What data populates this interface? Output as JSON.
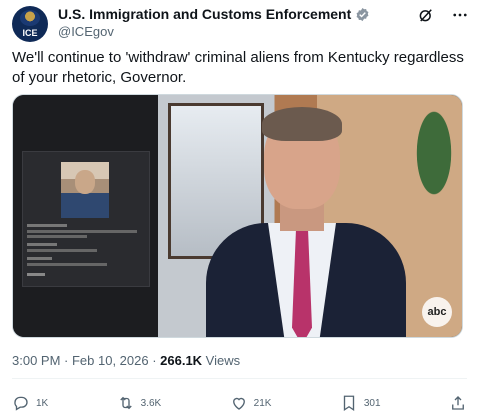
{
  "tweet": {
    "author_name": "U.S. Immigration and Customs Enforcement",
    "handle": "@ICEgov",
    "avatar_text": "ICE",
    "text": "We'll continue to 'withdraw' criminal aliens from Kentucky regardless of your rhetoric, Governor.",
    "time": "3:00 PM · Feb 10, 2026 · ",
    "views_count": "266.1K",
    "views_label": " Views"
  },
  "media": {
    "network_logo": "abc"
  },
  "actions": {
    "replies": "1K",
    "reposts": "3.6K",
    "likes": "21K",
    "bookmarks": "301"
  },
  "colors": {
    "verified": "#1d9bf0",
    "tie": "#b8336a"
  },
  "icons": [
    "verified-badge-icon",
    "grok-icon",
    "more-icon",
    "reply-icon",
    "repost-icon",
    "like-icon",
    "bookmark-icon",
    "share-icon"
  ]
}
